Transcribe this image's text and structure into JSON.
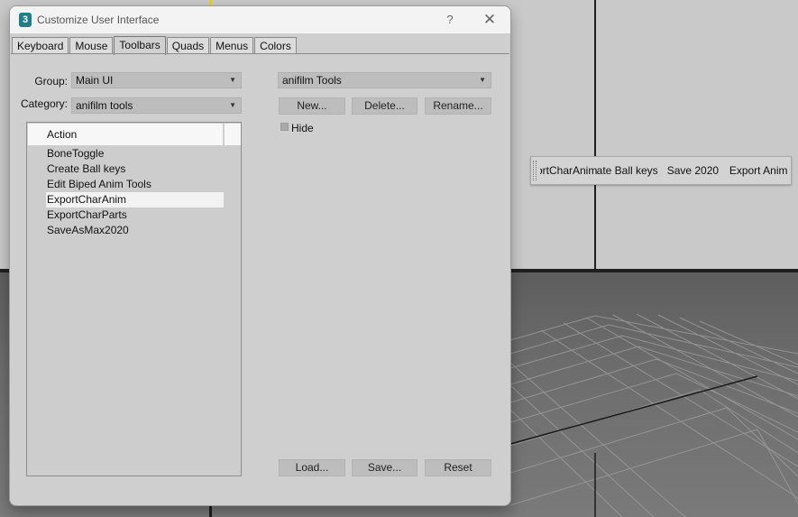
{
  "dialog": {
    "title": "Customize User Interface",
    "help": "?",
    "close": "✕",
    "app_icon": "3",
    "tabs": [
      "Keyboard",
      "Mouse",
      "Toolbars",
      "Quads",
      "Menus",
      "Colors"
    ],
    "active_tab": "Toolbars"
  },
  "left": {
    "group_label": "Group:",
    "group_value": "Main UI",
    "category_label": "Category:",
    "category_value": "anifilm tools",
    "list_header": "Action",
    "actions": [
      "BoneToggle",
      "Create Ball keys",
      "Edit Biped Anim Tools",
      "ExportCharAnim",
      "ExportCharParts",
      "SaveAsMax2020"
    ],
    "selected_action": "ExportCharAnim"
  },
  "right": {
    "toolbar_select": "anifilm Tools",
    "new_label": "New...",
    "delete_label": "Delete...",
    "rename_label": "Rename...",
    "hide_label": "Hide",
    "hide_checked": false,
    "load_label": "Load...",
    "save_label": "Save...",
    "reset_label": "Reset"
  },
  "floating_toolbar": {
    "buttons": [
      "ExportCharAnim",
      "Create Ball keys",
      "Save 2020",
      "Export Anim"
    ]
  },
  "icons": {
    "dropdown_arrow": "▼"
  }
}
